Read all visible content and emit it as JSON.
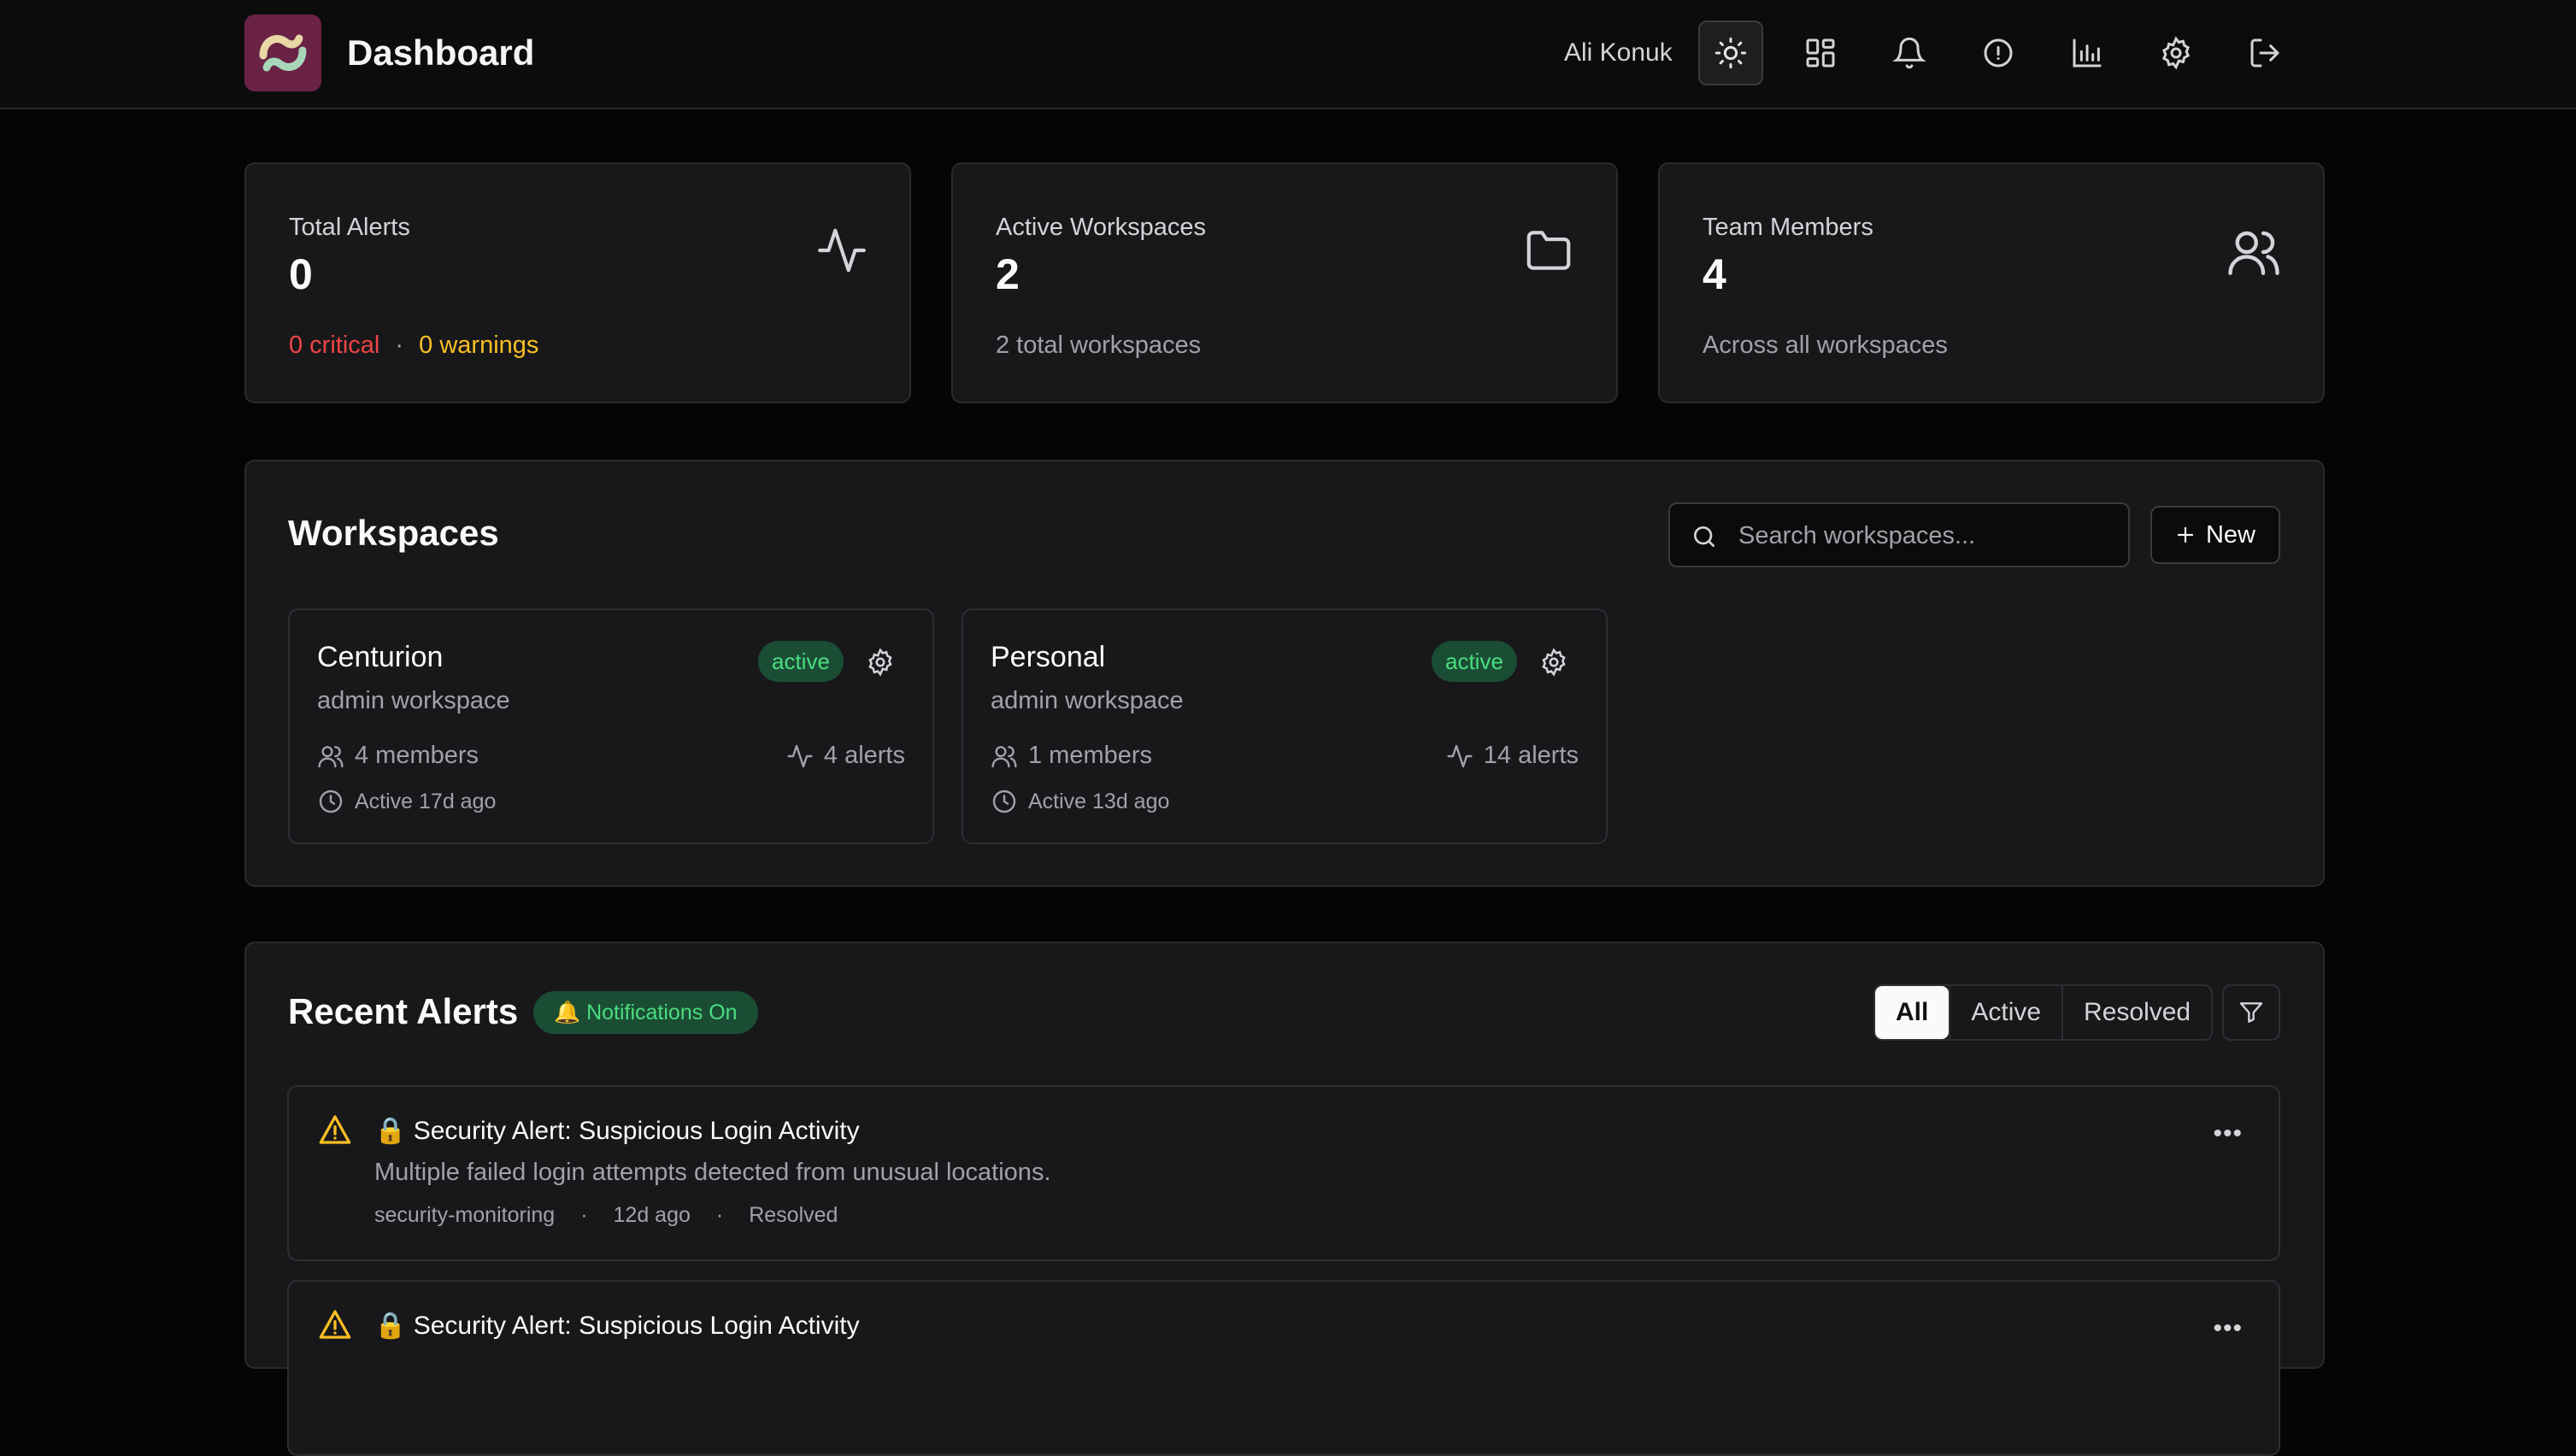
{
  "header": {
    "title": "Dashboard",
    "user": "Ali Konuk",
    "icons": [
      "sun-icon",
      "grid-icon",
      "bell-icon",
      "alert-circle-icon",
      "bar-chart-icon",
      "gear-icon",
      "logout-icon"
    ]
  },
  "stats": [
    {
      "label": "Total Alerts",
      "value": "0",
      "critical": "0 critical",
      "sep": "·",
      "warnings": "0 warnings",
      "icon": "activity-icon"
    },
    {
      "label": "Active Workspaces",
      "value": "2",
      "sub": "2 total workspaces",
      "icon": "folder-icon"
    },
    {
      "label": "Team Members",
      "value": "4",
      "sub": "Across all workspaces",
      "icon": "users-icon"
    }
  ],
  "workspaces": {
    "title": "Workspaces",
    "search_placeholder": "Search workspaces...",
    "new_label": "New",
    "items": [
      {
        "name": "Centurion",
        "role": "admin workspace",
        "status": "active",
        "members": "4 members",
        "alerts": "4 alerts",
        "last_active": "Active 17d ago"
      },
      {
        "name": "Personal",
        "role": "admin workspace",
        "status": "active",
        "members": "1 members",
        "alerts": "14 alerts",
        "last_active": "Active 13d ago"
      }
    ]
  },
  "alerts": {
    "title": "Recent Alerts",
    "notifications": "🔔 Notifications On",
    "filters": [
      "All",
      "Active",
      "Resolved"
    ],
    "selected_filter": "All",
    "items": [
      {
        "title": "🔒 Security Alert: Suspicious Login Activity",
        "description": "Multiple failed login attempts detected from unusual locations.",
        "source": "security-monitoring",
        "time": "12d ago",
        "status": "Resolved",
        "sep": "·"
      },
      {
        "title": "🔒 Security Alert: Suspicious Login Activity",
        "description": "",
        "source": "",
        "time": "",
        "status": "",
        "sep": ""
      }
    ]
  },
  "colors": {
    "background": "#050505",
    "card": "#18181b",
    "badge_bg": "#1b4d35",
    "badge_text": "#4ade80",
    "critical": "#ef4444",
    "warning": "#fbbf24",
    "logo": "#6a2245"
  }
}
